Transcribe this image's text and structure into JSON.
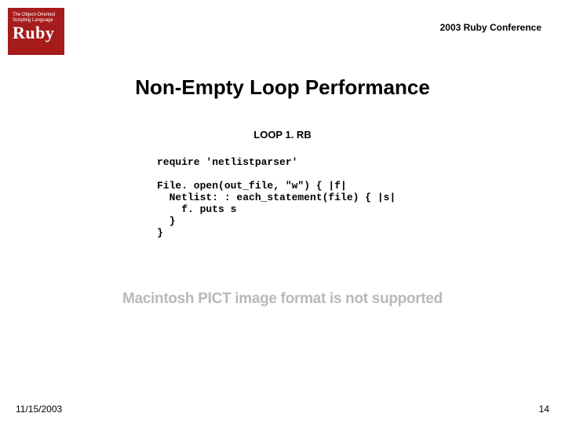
{
  "header": {
    "logo_tagline": "The Object-Oriented Scripting Language",
    "logo_name": "Ruby",
    "conference": "2003 Ruby Conference"
  },
  "title": "Non-Empty Loop Performance",
  "file_label": "LOOP 1. RB",
  "code": "require 'netlistparser'\n\nFile. open(out_file, \"w\") { |f|\n  Netlist: : each_statement(file) { |s|\n    f. puts s\n  }\n}",
  "pict_message": "Macintosh PICT\nimage format\nis not supported",
  "footer": {
    "date": "11/15/2003",
    "page": "14"
  }
}
